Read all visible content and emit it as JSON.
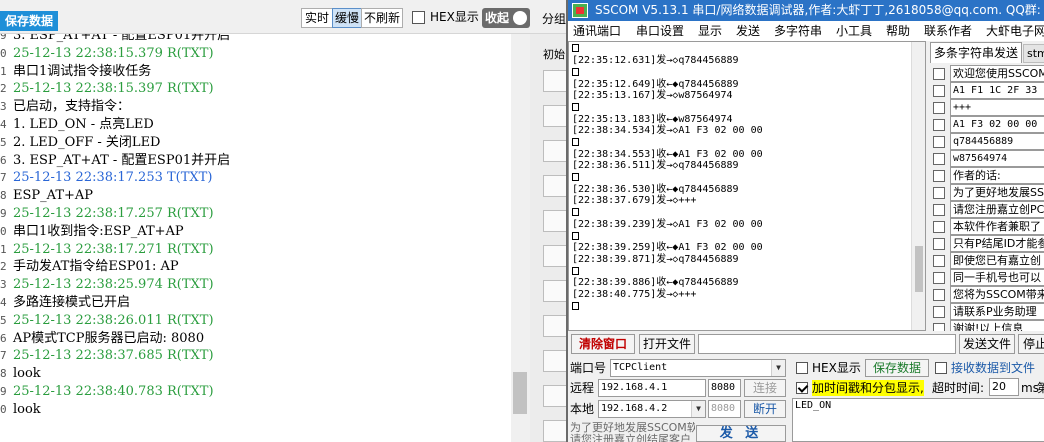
{
  "left": {
    "save_data": "保存数据",
    "mode_realtime": "实时",
    "mode_buffer": "缓慢",
    "mode_no_refresh": "不刷新",
    "hex_display": "HEX显示",
    "collapse": "收起",
    "side_fen": "分组",
    "side_chu": "初始",
    "log": [
      {
        "n": "9",
        "text": "3. ESP_AT+AT - 配置ESP01并开启",
        "kind": "text"
      },
      {
        "n": "0",
        "text": "25-12-13 22:38:15.379 R(TXT)",
        "kind": "ts"
      },
      {
        "n": "1",
        "text": "串口1调试指令接收任务",
        "kind": "text"
      },
      {
        "n": "2",
        "text": "25-12-13 22:38:15.397 R(TXT)",
        "kind": "ts"
      },
      {
        "n": "3",
        "text": "已启动，支持指令：",
        "kind": "text"
      },
      {
        "n": "4",
        "text": "1. LED_ON - 点亮LED",
        "kind": "text"
      },
      {
        "n": "5",
        "text": "2. LED_OFF - 关闭LED",
        "kind": "text"
      },
      {
        "n": "6",
        "text": "3. ESP_AT+AT - 配置ESP01并开启",
        "kind": "text"
      },
      {
        "n": "7",
        "text": "25-12-13 22:38:17.253 T(TXT)",
        "kind": "tx"
      },
      {
        "n": "8",
        "text": "ESP_AT+AP",
        "kind": "text"
      },
      {
        "n": "9",
        "text": "25-12-13 22:38:17.257 R(TXT)",
        "kind": "ts"
      },
      {
        "n": "0",
        "text": "串口1收到指令:ESP_AT+AP",
        "kind": "text"
      },
      {
        "n": "1",
        "text": "25-12-13 22:38:17.271 R(TXT)",
        "kind": "ts"
      },
      {
        "n": "2",
        "text": "手动发AT指令给ESP01: AP",
        "kind": "text"
      },
      {
        "n": "3",
        "text": "25-12-13 22:38:25.974 R(TXT)",
        "kind": "ts"
      },
      {
        "n": "4",
        "text": "多路连接模式已开启",
        "kind": "text"
      },
      {
        "n": "5",
        "text": "25-12-13 22:38:26.011 R(TXT)",
        "kind": "ts"
      },
      {
        "n": "6",
        "text": "AP模式TCP服务器已启动: 8080",
        "kind": "text"
      },
      {
        "n": "7",
        "text": "25-12-13 22:38:37.685 R(TXT)",
        "kind": "ts"
      },
      {
        "n": "8",
        "text": "look",
        "kind": "text"
      },
      {
        "n": "9",
        "text": "25-12-13 22:38:40.783 R(TXT)",
        "kind": "ts"
      },
      {
        "n": "0",
        "text": "look",
        "kind": "text"
      }
    ]
  },
  "sscom": {
    "title": "SSCOM V5.13.1 串口/网络数据调试器,作者:大虾丁丁,2618058@qq.com. QQ群: 52502449",
    "menu": [
      "通讯端口",
      "串口设置",
      "显示",
      "发送",
      "多字符串",
      "小工具",
      "帮助",
      "联系作者",
      "大虾电子网"
    ],
    "rx_lines": [
      {
        "text": "",
        "box": true
      },
      {
        "text": "[22:35:12.631]发→◇q784456889",
        "box": false
      },
      {
        "text": "",
        "box": true
      },
      {
        "text": "[22:35:12.649]收←◆q784456889",
        "box": false
      },
      {
        "text": "[22:35:13.167]发→◇w87564974",
        "box": false
      },
      {
        "text": "",
        "box": true
      },
      {
        "text": "[22:35:13.183]收←◆w87564974",
        "box": false
      },
      {
        "text": "[22:38:34.534]发→◇A1 F3 02 00 00",
        "box": false
      },
      {
        "text": "",
        "box": true
      },
      {
        "text": "[22:38:34.553]收←◆A1 F3 02 00 00",
        "box": false
      },
      {
        "text": "[22:38:36.511]发→◇q784456889",
        "box": false
      },
      {
        "text": "",
        "box": true
      },
      {
        "text": "[22:38:36.530]收←◆q784456889",
        "box": false
      },
      {
        "text": "[22:38:37.679]发→◇+++",
        "box": false
      },
      {
        "text": "",
        "box": true
      },
      {
        "text": "[22:38:39.239]发→◇A1 F3 02 00 00",
        "box": false
      },
      {
        "text": "",
        "box": true
      },
      {
        "text": "[22:38:39.259]收←◆A1 F3 02 00 00",
        "box": false
      },
      {
        "text": "[22:38:39.871]发→◇q784456889",
        "box": false
      },
      {
        "text": "",
        "box": true
      },
      {
        "text": "[22:38:39.886]收←◆q784456889",
        "box": false
      },
      {
        "text": "[22:38:40.775]发→◇+++",
        "box": false
      },
      {
        "text": "",
        "box": true
      }
    ],
    "multi_tab": "多条字符串发送",
    "multi_tab2": "stm",
    "multi_rows": [
      {
        "text": "欢迎您使用SSCOM",
        "note": true
      },
      {
        "text": "A1 F1 1C 2F 33",
        "note": false
      },
      {
        "text": "+++",
        "note": false
      },
      {
        "text": "A1 F3 02 00 00",
        "note": false
      },
      {
        "text": "q784456889",
        "note": false
      },
      {
        "text": "w87564974",
        "note": false
      },
      {
        "text": "作者的话:",
        "note": true
      },
      {
        "text": "为了更好地发展SS",
        "note": true
      },
      {
        "text": "请您注册嘉立创PC",
        "note": true
      },
      {
        "text": "本软件作者兼职了",
        "note": true
      },
      {
        "text": "只有P结尾ID才能参",
        "note": true
      },
      {
        "text": "即使您已有嘉立创",
        "note": true
      },
      {
        "text": "同一手机号也可以",
        "note": true
      },
      {
        "text": "您将为SSCOM带来",
        "note": true
      },
      {
        "text": "请联系P业务助理",
        "note": true
      },
      {
        "text": "谢谢!以上信息",
        "note": true
      }
    ],
    "clear_window": "清除窗口",
    "open_file": "打开文件",
    "send_file": "发送文件",
    "stop": "停止",
    "port_label": "端口号",
    "port_value": "TCPClient",
    "remote_label": "远程",
    "remote_ip": "192.168.4.1",
    "remote_port": "8080",
    "connect": "连接",
    "local_label": "本地",
    "local_ip": "192.168.4.2",
    "local_port": "8080",
    "disconnect": "断开",
    "hex_display": "HEX显示",
    "save_data": "保存数据",
    "recv_to_file": "接收数据到文件",
    "timestamp_label": "加时间戳和分包显示,",
    "timeout_label": "超时时间:",
    "timeout_value": "20",
    "timeout_unit": "ms",
    "timeout_tail": "第",
    "note_text": "为了更好地发展SSCOM软件\n请您注册嘉立创结尾客户",
    "send": "发 送",
    "tx_text": "LED_ON"
  }
}
